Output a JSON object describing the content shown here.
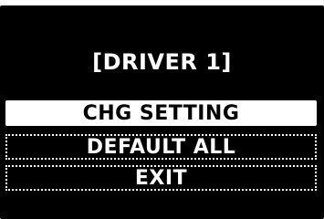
{
  "screen": {
    "title": "[DRIVER 1]",
    "selected_index": 0,
    "menu": [
      {
        "label": "CHG SETTING"
      },
      {
        "label": "DEFAULT ALL"
      },
      {
        "label": "EXIT"
      }
    ]
  },
  "colors": {
    "background": "#000000",
    "foreground": "#ffffff",
    "highlight_background": "#ffffff",
    "highlight_text": "#000000"
  }
}
